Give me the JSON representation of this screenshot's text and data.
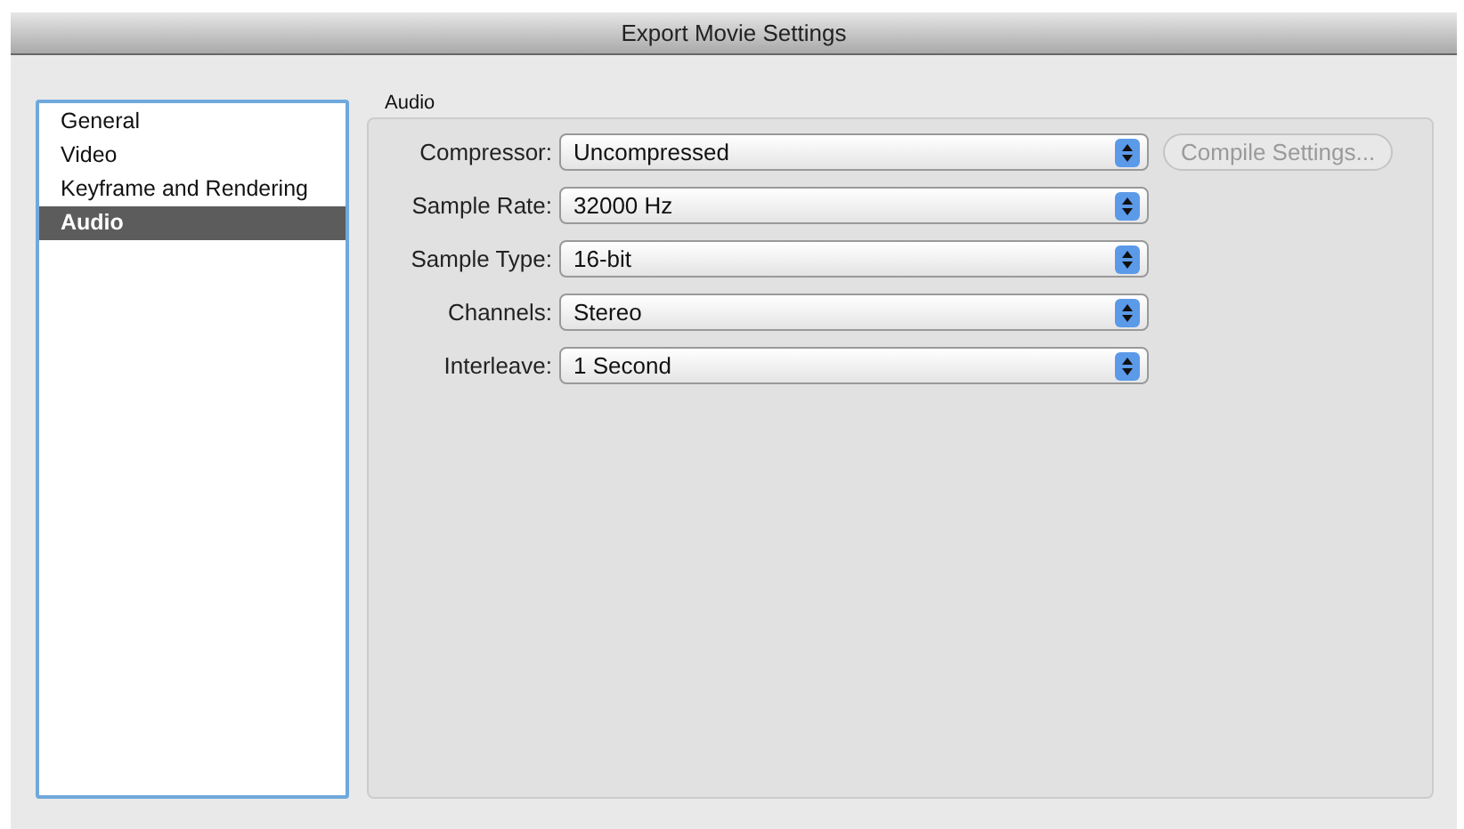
{
  "window": {
    "title": "Export Movie Settings"
  },
  "sidebar": {
    "items": [
      {
        "label": "General",
        "selected": false
      },
      {
        "label": "Video",
        "selected": false
      },
      {
        "label": "Keyframe and Rendering",
        "selected": false
      },
      {
        "label": "Audio",
        "selected": true
      }
    ]
  },
  "group": {
    "title": "Audio"
  },
  "fields": [
    {
      "label": "Compressor:",
      "value": "Uncompressed"
    },
    {
      "label": "Sample Rate:",
      "value": "32000 Hz"
    },
    {
      "label": "Sample Type:",
      "value": "16-bit"
    },
    {
      "label": "Channels:",
      "value": "Stereo"
    },
    {
      "label": "Interleave:",
      "value": "1 Second"
    }
  ],
  "compile_button": {
    "label": "Compile Settings...",
    "disabled": true
  }
}
